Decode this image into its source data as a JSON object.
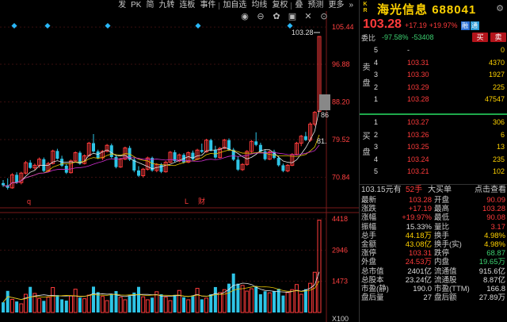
{
  "colors": {
    "up": "#ff3b3b",
    "down": "#3cd070",
    "ma_white": "#e6e6e6",
    "ma_yellow": "#e6c300",
    "accent": "#ffd200"
  },
  "toolbar": {
    "items": [
      "发",
      "PK",
      "简",
      "九转",
      "连板",
      "事件",
      "加自选",
      "均线",
      "复权",
      "叠",
      "预测",
      "更多"
    ],
    "more_arrow": "»"
  },
  "tool_icons": [
    "eye-icon",
    "zoom-icon",
    "gear-icon",
    "image-icon",
    "close-icon",
    "arrow-up-icon"
  ],
  "chart": {
    "price_axis_labels": [
      "105.44",
      "96.88",
      "88.20",
      "79.52",
      "70.84"
    ],
    "volume_axis_labels": [
      "4418",
      "2946",
      "1473",
      "X100"
    ],
    "top_price_label": "103.28",
    "tag_86": "86",
    "tag_81": "81.",
    "markers": [
      "q",
      "L",
      "财"
    ]
  },
  "chart_data": {
    "type": "candlestick",
    "ylim": [
      66.0,
      106.2
    ],
    "last_close": 103.28,
    "candles": [
      [
        69.5,
        70.2,
        68.6,
        69.0
      ],
      [
        69.0,
        70.6,
        68.0,
        68.4
      ],
      [
        68.4,
        71.8,
        68.2,
        71.4
      ],
      [
        71.4,
        72.0,
        69.3,
        69.6
      ],
      [
        69.6,
        72.1,
        69.2,
        71.8
      ],
      [
        71.8,
        74.6,
        71.5,
        74.2
      ],
      [
        74.2,
        74.8,
        72.8,
        73.0
      ],
      [
        73.0,
        74.0,
        72.5,
        73.6
      ],
      [
        73.6,
        75.4,
        73.0,
        75.0
      ],
      [
        75.0,
        75.4,
        72.0,
        72.3
      ],
      [
        72.3,
        74.4,
        72.0,
        74.0
      ],
      [
        74.0,
        77.2,
        73.8,
        76.9
      ],
      [
        76.9,
        77.4,
        74.9,
        75.1
      ],
      [
        75.1,
        75.8,
        73.2,
        73.5
      ],
      [
        73.5,
        73.9,
        71.6,
        71.9
      ],
      [
        71.9,
        74.9,
        71.7,
        74.6
      ],
      [
        74.6,
        76.8,
        74.3,
        76.5
      ],
      [
        76.5,
        76.9,
        73.7,
        74.0
      ],
      [
        74.0,
        76.1,
        73.8,
        75.8
      ],
      [
        75.8,
        79.0,
        75.6,
        78.7
      ],
      [
        78.7,
        80.8,
        76.5,
        76.8
      ],
      [
        76.8,
        77.2,
        75.0,
        75.3
      ],
      [
        75.3,
        77.1,
        74.8,
        76.8
      ],
      [
        76.8,
        78.5,
        76.6,
        78.2
      ],
      [
        78.2,
        78.6,
        75.2,
        75.5
      ],
      [
        75.5,
        76.0,
        72.9,
        73.2
      ],
      [
        73.2,
        75.3,
        73.0,
        75.0
      ],
      [
        75.0,
        77.9,
        74.8,
        77.6
      ],
      [
        77.6,
        78.1,
        74.6,
        74.9
      ],
      [
        74.9,
        75.3,
        72.0,
        72.4
      ],
      [
        72.4,
        73.4,
        70.9,
        71.2
      ],
      [
        71.2,
        73.0,
        70.8,
        72.7
      ],
      [
        72.7,
        75.6,
        72.4,
        75.3
      ],
      [
        75.3,
        75.6,
        72.1,
        72.4
      ],
      [
        72.4,
        74.1,
        72.0,
        73.8
      ],
      [
        73.8,
        74.1,
        71.8,
        72.1
      ],
      [
        72.1,
        74.6,
        71.9,
        74.3
      ],
      [
        74.3,
        76.9,
        74.1,
        76.6
      ],
      [
        76.6,
        77.1,
        74.3,
        74.6
      ],
      [
        74.6,
        76.3,
        74.3,
        76.0
      ],
      [
        76.0,
        76.4,
        74.0,
        74.3
      ],
      [
        74.3,
        76.8,
        74.1,
        76.5
      ],
      [
        76.5,
        77.0,
        74.7,
        75.0
      ],
      [
        75.0,
        77.4,
        74.8,
        77.1
      ],
      [
        77.1,
        78.6,
        76.4,
        76.7
      ],
      [
        76.7,
        79.7,
        76.5,
        79.4
      ],
      [
        79.4,
        79.7,
        76.8,
        77.1
      ],
      [
        77.1,
        78.1,
        75.1,
        75.4
      ],
      [
        75.4,
        77.8,
        75.2,
        77.5
      ],
      [
        77.5,
        79.7,
        77.3,
        79.4
      ],
      [
        79.4,
        79.8,
        76.9,
        77.2
      ],
      [
        77.2,
        77.6,
        74.6,
        74.9
      ],
      [
        74.9,
        75.6,
        72.3,
        72.6
      ],
      [
        72.6,
        74.1,
        72.3,
        73.8
      ],
      [
        73.8,
        77.1,
        73.5,
        76.8
      ],
      [
        76.8,
        79.4,
        76.5,
        79.1
      ],
      [
        79.1,
        81.2,
        78.0,
        78.3
      ],
      [
        78.3,
        78.8,
        76.5,
        76.8
      ],
      [
        76.8,
        77.3,
        74.7,
        75.0
      ],
      [
        75.0,
        77.0,
        74.8,
        76.7
      ],
      [
        76.7,
        77.2,
        75.0,
        75.3
      ],
      [
        75.3,
        75.7,
        73.3,
        73.6
      ],
      [
        73.6,
        74.0,
        72.0,
        72.3
      ],
      [
        72.3,
        73.9,
        72.0,
        73.6
      ],
      [
        73.6,
        76.4,
        73.4,
        76.1
      ],
      [
        76.1,
        79.0,
        75.9,
        78.7
      ],
      [
        78.7,
        80.6,
        78.0,
        80.3
      ],
      [
        80.3,
        81.3,
        79.2,
        79.4
      ],
      [
        79.4,
        83.5,
        79.0,
        83.1
      ],
      [
        83.1,
        86.1,
        82.6,
        85.8
      ],
      [
        86.0,
        103.3,
        86.0,
        103.28
      ]
    ],
    "volumes": [
      480,
      1020,
      620,
      520,
      410,
      860,
      1210,
      900,
      660,
      550,
      720,
      1180,
      820,
      620,
      560,
      780,
      1100,
      700,
      650,
      820,
      1220,
      960,
      760,
      560,
      880,
      1010,
      720,
      600,
      780,
      940,
      1210,
      740,
      600,
      700,
      980,
      860,
      720,
      560,
      830,
      1040,
      720,
      600,
      780,
      1140,
      620,
      680,
      860,
      1200,
      940,
      1080,
      1360,
      1840,
      1360,
      1280,
      1010,
      1120,
      1220,
      860,
      1000,
      930,
      1000,
      1120,
      800,
      940,
      1080,
      1320,
      860,
      1100,
      1380,
      1900,
      4360
    ]
  },
  "quote": {
    "kr_tag": [
      "K",
      "R"
    ],
    "name": "海光信息",
    "code": "688041",
    "last": "103.28",
    "change": "+17.19",
    "change_pct": "+19.97%",
    "badge1": "融",
    "badge2": "通",
    "ratio_label": "委比",
    "ratio_pct": "-97.58%",
    "ratio_diff": "-53408",
    "buy_btn": "买",
    "sell_btn": "卖",
    "sell_side_label": [
      "卖",
      "盘"
    ],
    "buy_side_label": [
      "买",
      "盘"
    ],
    "asks": [
      {
        "level": "5",
        "price": "-",
        "vol": "0"
      },
      {
        "level": "4",
        "price": "103.31",
        "vol": "4370"
      },
      {
        "level": "3",
        "price": "103.30",
        "vol": "1927"
      },
      {
        "level": "2",
        "price": "103.29",
        "vol": "225"
      },
      {
        "level": "1",
        "price": "103.28",
        "vol": "47547"
      }
    ],
    "bids": [
      {
        "level": "1",
        "price": "103.27",
        "vol": "306"
      },
      {
        "level": "2",
        "price": "103.26",
        "vol": "6"
      },
      {
        "level": "3",
        "price": "103.25",
        "vol": "13"
      },
      {
        "level": "4",
        "price": "103.24",
        "vol": "235"
      },
      {
        "level": "5",
        "price": "103.21",
        "vol": "102"
      }
    ],
    "trade_bar": {
      "amount": "103.15元有",
      "hands": "52手",
      "side": "大买单",
      "link": "点击查看"
    },
    "stats": [
      {
        "l1": "最新",
        "v1": "103.28",
        "c1": "red",
        "l2": "开盘",
        "v2": "90.09",
        "c2": "red"
      },
      {
        "l1": "涨跌",
        "v1": "+17.19",
        "c1": "red",
        "l2": "最高",
        "v2": "103.28",
        "c2": "red"
      },
      {
        "l1": "涨幅",
        "v1": "+19.97%",
        "c1": "red",
        "l2": "最低",
        "v2": "90.08",
        "c2": "red"
      },
      {
        "l1": "振幅",
        "v1": "15.33%",
        "c1": "white",
        "l2": "量比",
        "v2": "3.17",
        "c2": "red"
      },
      {
        "l1": "总手",
        "v1": "44.18万",
        "c1": "yellow",
        "l2": "换手",
        "v2": "4.98%",
        "c2": "yellow"
      },
      {
        "l1": "金额",
        "v1": "43.08亿",
        "c1": "yellow",
        "l2": "换手(实)",
        "v2": "4.98%",
        "c2": "yellow"
      },
      {
        "l1": "涨停",
        "v1": "103.31",
        "c1": "red",
        "l2": "跌停",
        "v2": "68.87",
        "c2": "green"
      },
      {
        "l1": "外盘",
        "v1": "24.53万",
        "c1": "red",
        "l2": "内盘",
        "v2": "19.65万",
        "c2": "green"
      },
      {
        "l1": "总市值",
        "v1": "2401亿",
        "c1": "white",
        "l2": "流通值",
        "v2": "915.6亿",
        "c2": "white"
      },
      {
        "l1": "总股本",
        "v1": "23.24亿",
        "c1": "white",
        "l2": "流通股",
        "v2": "8.87亿",
        "c2": "white"
      },
      {
        "l1": "市盈(静)",
        "v1": "190.0",
        "c1": "white",
        "l2": "市盈(TTM)",
        "v2": "166.8",
        "c2": "white"
      },
      {
        "l1": "盘后量",
        "v1": "27",
        "c1": "white",
        "l2": "盘后额",
        "v2": "27.89万",
        "c2": "white"
      }
    ]
  }
}
